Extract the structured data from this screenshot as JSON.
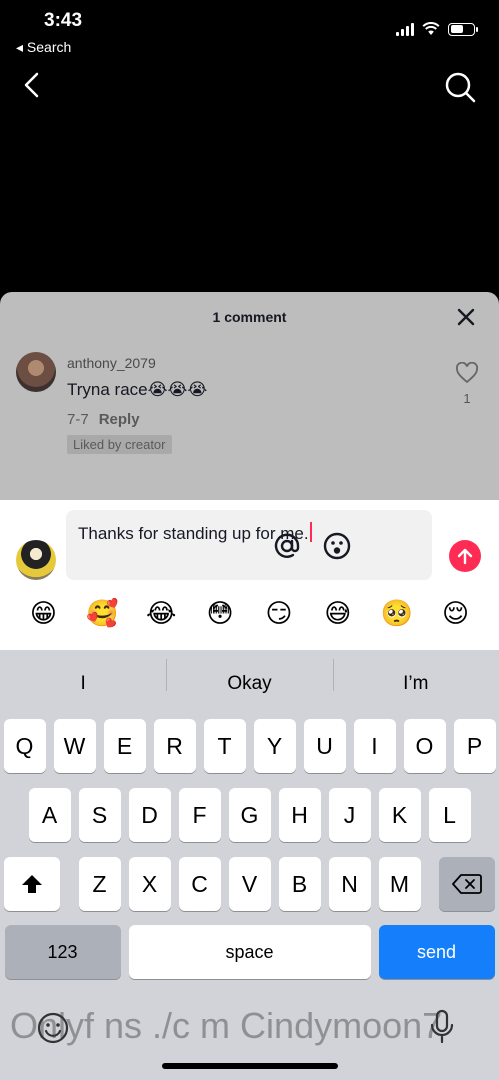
{
  "status_bar": {
    "time": "3:43",
    "back_app": "◂ Search"
  },
  "comments": {
    "title": "1 comment",
    "items": [
      {
        "username": "anthony_2079",
        "text": "Tryna race😭😭😭",
        "date": "7-7",
        "reply_label": "Reply",
        "badge": "Liked by creator",
        "like_count": "1"
      }
    ]
  },
  "composer": {
    "text": "Thanks for standing up for me.",
    "emojis": [
      "😁",
      "🥰",
      "😂",
      "😳",
      "😏",
      "😅",
      "🥺",
      "😌"
    ]
  },
  "keyboard": {
    "suggestions": [
      "I",
      "Okay",
      "I’m"
    ],
    "row1": [
      "Q",
      "W",
      "E",
      "R",
      "T",
      "Y",
      "U",
      "I",
      "O",
      "P"
    ],
    "row2": [
      "A",
      "S",
      "D",
      "F",
      "G",
      "H",
      "J",
      "K",
      "L"
    ],
    "row3": [
      "Z",
      "X",
      "C",
      "V",
      "B",
      "N",
      "M"
    ],
    "num_label": "123",
    "space_label": "space",
    "send_label": "send"
  },
  "watermark": "Onlyf ns ./c m Cindymoon7"
}
